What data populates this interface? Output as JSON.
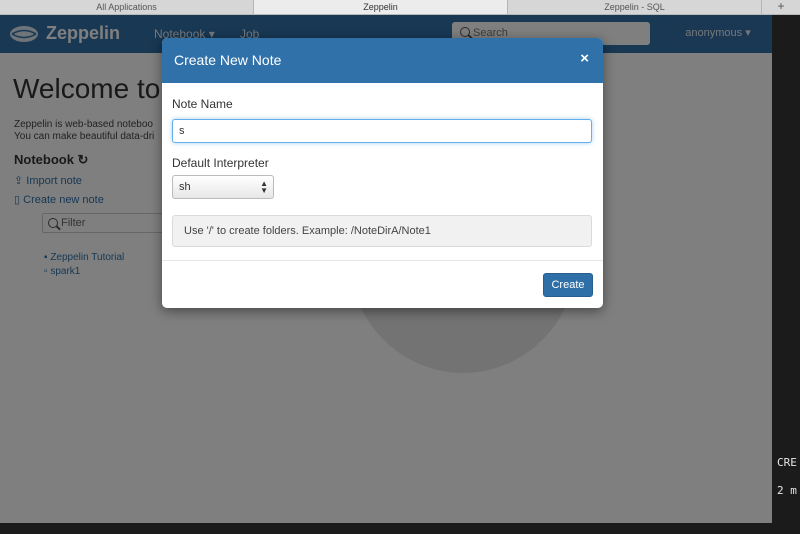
{
  "browser": {
    "tabs": [
      {
        "label": "All Applications"
      },
      {
        "label": "Zeppelin"
      },
      {
        "label": "Zeppelin - SQL"
      }
    ],
    "new_tab": "+"
  },
  "navbar": {
    "brand": "Zeppelin",
    "notebook_menu": "Notebook ▾",
    "job_link": "Job",
    "search_placeholder": "Search",
    "user": "anonymous ▾"
  },
  "page": {
    "welcome": "Welcome to Z",
    "desc_line1": "Zeppelin is web-based noteboo",
    "desc_line2": "You can make beautiful data-dri",
    "notebook_title": "Notebook ↻",
    "import_note": "Import note",
    "create_note": "Create new note",
    "filter_placeholder": "Filter",
    "tree": [
      {
        "label": "Zeppelin Tutorial"
      },
      {
        "label": "spark1"
      }
    ]
  },
  "modal": {
    "title": "Create New Note",
    "close": "×",
    "note_name_label": "Note Name",
    "note_name_value": "s",
    "interpreter_label": "Default Interpreter",
    "interpreter_value": "sh",
    "hint": "Use '/' to create folders. Example: /NoteDirA/Note1",
    "create_button": "Create"
  },
  "terminal": {
    "line1": "CRE",
    "line2": "2 m"
  },
  "colors": {
    "brand_blue": "#3071a9",
    "button_blue": "#2f6fa8"
  }
}
